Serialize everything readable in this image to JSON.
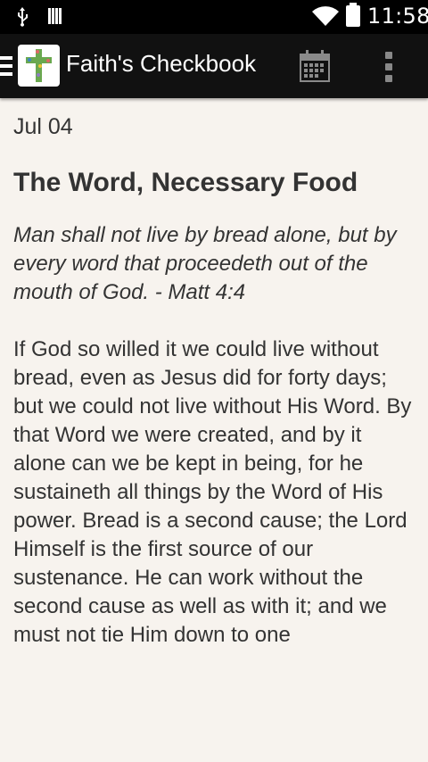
{
  "status_bar": {
    "time": "11:58",
    "icons": [
      "usb-icon",
      "signal-bars-icon",
      "wifi-icon",
      "battery-icon"
    ]
  },
  "action_bar": {
    "title": "Faith's Checkbook",
    "icons": [
      "drawer-icon",
      "cross-app-icon",
      "calendar-icon",
      "overflow-menu-icon"
    ]
  },
  "devotional": {
    "date": "Jul 04",
    "title": "The Word, Necessary Food",
    "verse": "Man shall not live by bread alone, but by every word that proceedeth out of the mouth of God. - Matt 4:4",
    "body": "If God so willed it we could live without bread, even as Jesus did for forty days; but we could not live without His Word. By that Word we were created, and by it alone can we be kept in being, for he sustaineth all things by the Word of His power. Bread is a second cause; the Lord Himself is the first source of our sustenance. He can work without the second cause as well as with it; and we must not tie Him down to one"
  },
  "colors": {
    "background": "#f7f3ee",
    "action_bar": "#111111",
    "status_bar": "#000000",
    "text": "#333333"
  }
}
